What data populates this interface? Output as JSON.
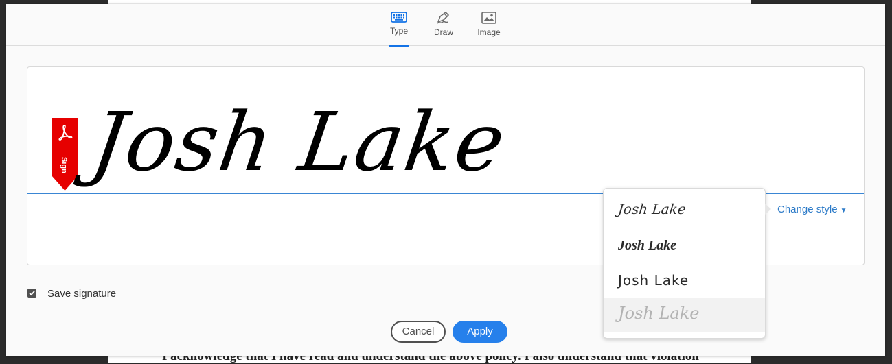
{
  "tabs": [
    {
      "id": "type",
      "label": "Type",
      "active": true,
      "icon": "keyboard-icon"
    },
    {
      "id": "draw",
      "label": "Draw",
      "active": false,
      "icon": "pen-draw-icon"
    },
    {
      "id": "image",
      "label": "Image",
      "active": false,
      "icon": "image-icon"
    }
  ],
  "signature": {
    "text": "Josh Lake",
    "ribbon_label": "Sign",
    "ribbon_color": "#e60000"
  },
  "change_style": {
    "label": "Change style"
  },
  "style_options": [
    {
      "label": "Josh Lake"
    },
    {
      "label": "Josh Lake"
    },
    {
      "label": "Josh Lake"
    },
    {
      "label": "Josh Lake",
      "selected": true
    }
  ],
  "save_signature": {
    "label": "Save signature",
    "checked": true
  },
  "buttons": {
    "cancel": "Cancel",
    "apply": "Apply"
  },
  "background_document": {
    "bottom_line": "I acknowledge that I have read and understand the above policy. I also understand that violation"
  },
  "colors": {
    "accent": "#1473e6",
    "apply": "#2680eb",
    "link": "#2d7bc8"
  }
}
